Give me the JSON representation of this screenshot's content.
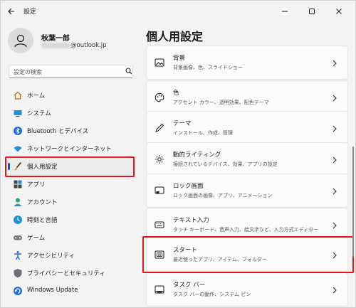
{
  "window": {
    "title": "設定"
  },
  "profile": {
    "name": "秋葉一郎",
    "email_suffix": "@outlook.jp"
  },
  "search": {
    "placeholder": "設定の検索"
  },
  "sidebar": {
    "items": [
      {
        "label": "ホーム",
        "icon": "home-icon"
      },
      {
        "label": "システム",
        "icon": "system-icon"
      },
      {
        "label": "Bluetooth とデバイス",
        "icon": "bluetooth-icon"
      },
      {
        "label": "ネットワークとインターネット",
        "icon": "network-icon"
      },
      {
        "label": "個人用設定",
        "icon": "brush-icon",
        "selected": true
      },
      {
        "label": "アプリ",
        "icon": "apps-icon"
      },
      {
        "label": "アカウント",
        "icon": "account-icon"
      },
      {
        "label": "時刻と言語",
        "icon": "time-language-icon"
      },
      {
        "label": "ゲーム",
        "icon": "gaming-icon"
      },
      {
        "label": "アクセシビリティ",
        "icon": "accessibility-icon"
      },
      {
        "label": "プライバシーとセキュリティ",
        "icon": "shield-icon"
      },
      {
        "label": "Windows Update",
        "icon": "update-icon"
      }
    ]
  },
  "main": {
    "title": "個人用設定",
    "cards": [
      {
        "title": "背景",
        "desc": "背景画像、色、スライドショー",
        "icon": "image-icon"
      },
      {
        "title": "色",
        "desc": "アクセント カラー、透明効果、配色テーマ",
        "icon": "palette-icon"
      },
      {
        "title": "テーマ",
        "desc": "インストール、作成、管理",
        "icon": "pen-icon"
      },
      {
        "title": "動的ライティング",
        "desc": "接続されているデバイス、効果、アプリの設定",
        "icon": "lighting-icon"
      },
      {
        "title": "ロック画面",
        "desc": "ロック画面の画像、アプリ、アニメーション",
        "icon": "lock-screen-icon"
      },
      {
        "title": "テキスト入力",
        "desc": "タッチ キーボード、音声入力、絵文字など、入力方式エディター",
        "icon": "keyboard-icon"
      },
      {
        "title": "スタート",
        "desc": "最近使ったアプリ、アイテム、フォルダー",
        "icon": "start-icon"
      },
      {
        "title": "タスク バー",
        "desc": "タスク バーの動作、システム ピン",
        "icon": "taskbar-icon"
      }
    ]
  },
  "colors": {
    "highlight": "#e8141c",
    "accent": "#005fb8"
  }
}
